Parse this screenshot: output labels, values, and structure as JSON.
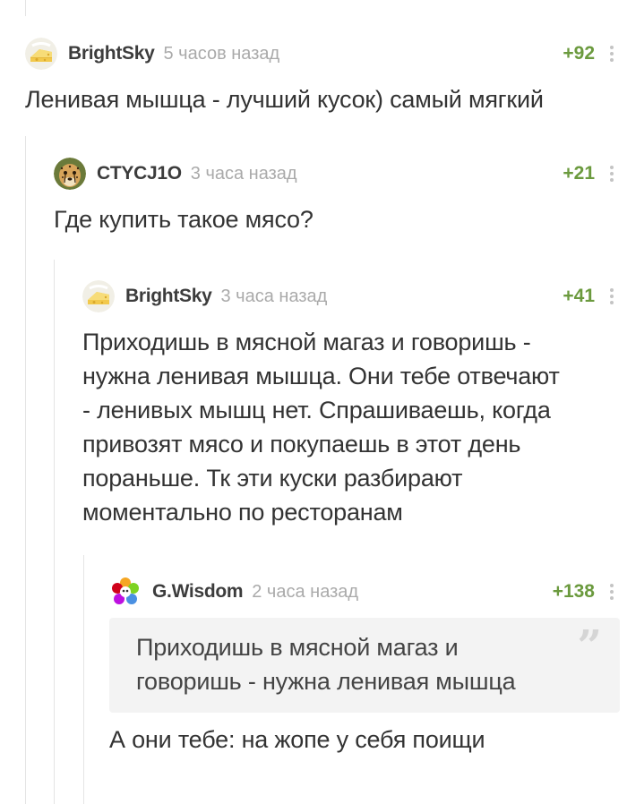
{
  "comments": [
    {
      "author": "BrightSky",
      "time": "5 часов назад",
      "rating": "+92",
      "avatar_icon": "cheese-icon",
      "text": "Ленивая мышца - лучший кусок) самый мягкий"
    },
    {
      "author": "CTYCJ1O",
      "time": "3 часа назад",
      "rating": "+21",
      "avatar_icon": "cheetah-icon",
      "text": "Где купить такое мясо?"
    },
    {
      "author": "BrightSky",
      "time": "3 часа назад",
      "rating": "+41",
      "avatar_icon": "cheese-icon",
      "lines": [
        "Приходишь в мясной магаз и говоришь -",
        "нужна ленивая мышца. Они тебе отвечают",
        "- ленивых мышц нет. Спрашиваешь, когда",
        "привозят мясо и покупаешь в этот день",
        "пораньше. Тк эти куски разбирают",
        "моментально по ресторанам"
      ]
    },
    {
      "author": "G.Wisdom",
      "time": "2 часа назад",
      "rating": "+138",
      "avatar_icon": "flower-icon",
      "quote_lines": [
        "Приходишь в мясной магаз и",
        "говоришь - нужна ленивая мышца"
      ],
      "quote_mark": "”",
      "text": "А они тебе: на жопе у себя поищи"
    }
  ],
  "colors": {
    "rating": "#6b9a3e",
    "time": "#aaaaaa",
    "author": "#3c3c3c",
    "quote_bg": "#f3f3f3"
  }
}
